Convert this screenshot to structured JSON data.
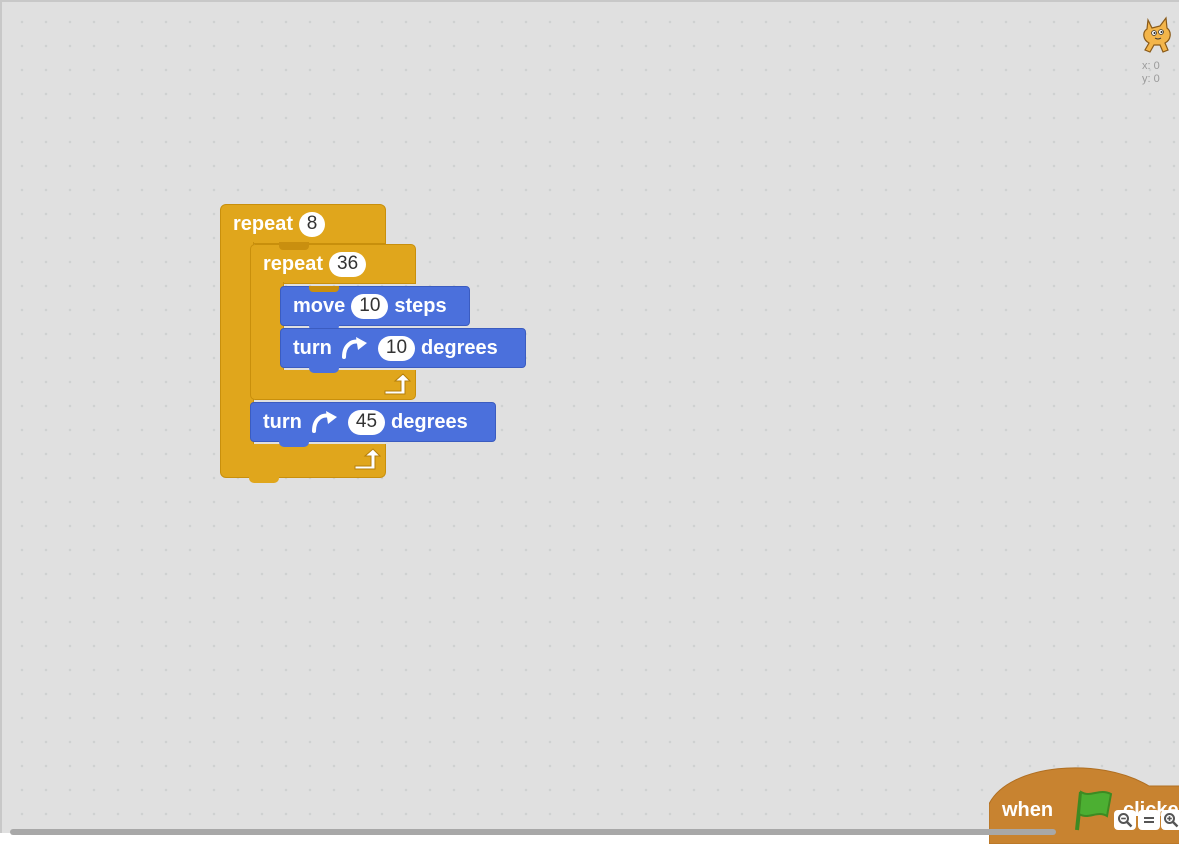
{
  "workspace": {
    "colors": {
      "control": "#e0a61c",
      "motion": "#4b70dc",
      "events": "#c88330",
      "flag": "#4caf32"
    }
  },
  "sprite": {
    "icon": "cat-sprite-icon",
    "x_label": "x: 0",
    "y_label": "y: 0"
  },
  "script": {
    "outer_repeat": {
      "label": "repeat",
      "count": "8"
    },
    "inner_repeat": {
      "label": "repeat",
      "count": "36"
    },
    "move": {
      "label": "move",
      "value": "10",
      "unit": "steps"
    },
    "turn_inner": {
      "label": "turn",
      "icon": "rotate-clockwise-icon",
      "value": "10",
      "unit": "degrees"
    },
    "turn_outer": {
      "label": "turn",
      "icon": "rotate-clockwise-icon",
      "value": "45",
      "unit": "degrees"
    }
  },
  "hat_block": {
    "label_when": "when",
    "icon": "green-flag-icon",
    "label_clicked": "clicked"
  },
  "zoom": {
    "zoom_out": "zoom-out-icon",
    "reset": "zoom-reset-icon",
    "zoom_in": "zoom-in-icon"
  }
}
